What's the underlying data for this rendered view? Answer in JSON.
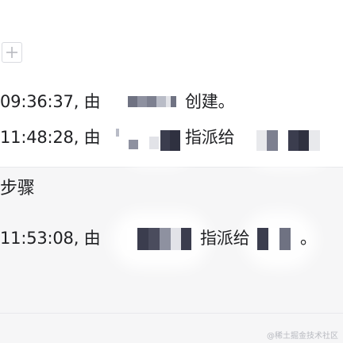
{
  "log": {
    "entries": [
      {
        "time": "09:36:37, 由",
        "action": "创建。"
      },
      {
        "time": "11:48:28, 由",
        "action": "指派给"
      }
    ],
    "section_title": "步骤",
    "step_entries": [
      {
        "time": "11:53:08, 由",
        "action": "指派给",
        "tail": "。"
      }
    ]
  },
  "toolbar": {
    "add_icon": "plus-icon"
  },
  "colors": {
    "text": "#202124",
    "mosaic_dark": "#3b3d4e",
    "mosaic_mid": "#6f7282",
    "mosaic_light": "#b9bcc7",
    "background": "#f6f6f7"
  },
  "watermark": "@稀土掘金技术社区"
}
